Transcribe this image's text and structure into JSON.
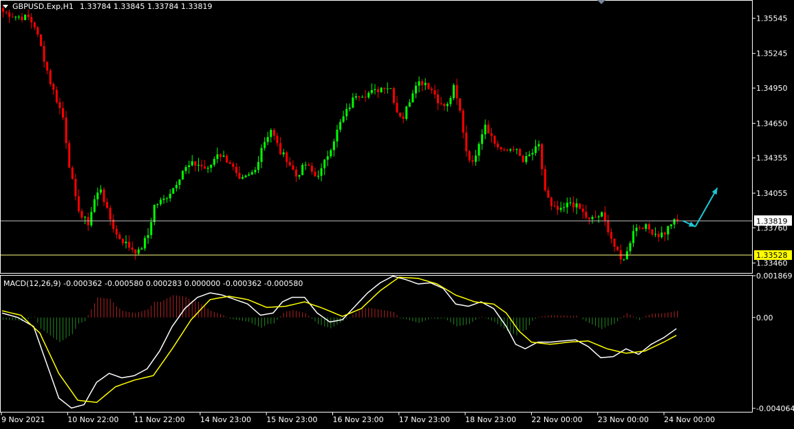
{
  "header": {
    "symbol": "GBPUSD.Exp,H1",
    "ohlc": "1.33784 1.33845 1.33784 1.33819"
  },
  "macd_header": "MACD(12,26,9) -0.000362 -0.000580 0.000283 0.000000 -0.000362 -0.000580",
  "colors": {
    "background": "#000000",
    "frame": "#ffffff",
    "bull": "#00ff00",
    "bear": "#ff0000",
    "macd_line": "#ffffff",
    "signal_line": "#ffff00",
    "hist_pos": "#b22222",
    "hist_neg": "#228b22",
    "price_line": "#c0c0c0",
    "level_line": "#ffff80",
    "level_label_bg": "#ffff00",
    "arrow": "#1fc7d4"
  },
  "chart_data": [
    {
      "type": "candlestick",
      "title": "GBPUSD.Exp,H1",
      "ylim": [
        1.3337,
        1.357
      ],
      "y_ticks": [
        "1.35545",
        "1.35245",
        "1.34950",
        "1.34650",
        "1.34355",
        "1.34055",
        "1.33760",
        "1.33460"
      ],
      "x_ticks": [
        "9 Nov 2021",
        "10 Nov 22:00",
        "11 Nov 22:00",
        "14 Nov 23:00",
        "15 Nov 23:00",
        "16 Nov 23:00",
        "17 Nov 23:00",
        "18 Nov 23:00",
        "22 Nov 00:00",
        "23 Nov 00:00",
        "24 Nov 00:00"
      ],
      "current_price": "1.33819",
      "level": "1.33528",
      "close_path": [
        [
          0,
          1.356
        ],
        [
          4,
          1.3556
        ],
        [
          8,
          1.3555
        ],
        [
          10,
          1.3548
        ],
        [
          12,
          1.353
        ],
        [
          15,
          1.35
        ],
        [
          17,
          1.3485
        ],
        [
          19,
          1.347
        ],
        [
          21,
          1.343
        ],
        [
          23,
          1.34
        ],
        [
          25,
          1.3385
        ],
        [
          27,
          1.338
        ],
        [
          29,
          1.34
        ],
        [
          31,
          1.341
        ],
        [
          33,
          1.339
        ],
        [
          36,
          1.337
        ],
        [
          40,
          1.336
        ],
        [
          43,
          1.3355
        ],
        [
          46,
          1.337
        ],
        [
          48,
          1.3395
        ],
        [
          51,
          1.34
        ],
        [
          54,
          1.341
        ],
        [
          57,
          1.3425
        ],
        [
          60,
          1.343
        ],
        [
          62,
          1.343
        ],
        [
          65,
          1.3425
        ],
        [
          68,
          1.344
        ],
        [
          72,
          1.3432
        ],
        [
          75,
          1.3415
        ],
        [
          78,
          1.342
        ],
        [
          80,
          1.3425
        ],
        [
          82,
          1.3445
        ],
        [
          85,
          1.346
        ],
        [
          88,
          1.344
        ],
        [
          90,
          1.3435
        ],
        [
          93,
          1.342
        ],
        [
          96,
          1.343
        ],
        [
          99,
          1.342
        ],
        [
          101,
          1.3425
        ],
        [
          104,
          1.3445
        ],
        [
          107,
          1.3465
        ],
        [
          109,
          1.3475
        ],
        [
          112,
          1.349
        ],
        [
          115,
          1.349
        ],
        [
          118,
          1.3492
        ],
        [
          121,
          1.3497
        ],
        [
          123,
          1.3495
        ],
        [
          125,
          1.3475
        ],
        [
          127,
          1.347
        ],
        [
          129,
          1.3485
        ],
        [
          131,
          1.35
        ],
        [
          134,
          1.35
        ],
        [
          137,
          1.349
        ],
        [
          139,
          1.348
        ],
        [
          141,
          1.348
        ],
        [
          143,
          1.3495
        ],
        [
          145,
          1.3475
        ],
        [
          147,
          1.3442
        ],
        [
          149,
          1.343
        ],
        [
          151,
          1.345
        ],
        [
          153,
          1.3465
        ],
        [
          156,
          1.3448
        ],
        [
          159,
          1.344
        ],
        [
          162,
          1.3445
        ],
        [
          165,
          1.3432
        ],
        [
          168,
          1.344
        ],
        [
          170,
          1.3445
        ],
        [
          172,
          1.3408
        ],
        [
          174,
          1.3393
        ],
        [
          177,
          1.339
        ],
        [
          180,
          1.3398
        ],
        [
          183,
          1.3392
        ],
        [
          186,
          1.3382
        ],
        [
          188,
          1.3385
        ],
        [
          190,
          1.3387
        ],
        [
          192,
          1.3375
        ],
        [
          194,
          1.336
        ],
        [
          196,
          1.3348
        ],
        [
          198,
          1.3355
        ],
        [
          200,
          1.3375
        ],
        [
          203,
          1.3378
        ],
        [
          206,
          1.3373
        ],
        [
          208,
          1.337
        ],
        [
          210,
          1.3372
        ],
        [
          212,
          1.338
        ],
        [
          214,
          1.33819
        ]
      ],
      "forecast_arrows": [
        {
          "from": [
            216,
            1.3382
          ],
          "to": [
            220,
            1.3377
          ]
        },
        {
          "from": [
            220,
            1.3377
          ],
          "to": [
            227,
            1.341
          ]
        }
      ]
    },
    {
      "type": "macd",
      "title": "MACD(12,26,9)",
      "values": [
        "-0.000362",
        "-0.000580",
        "0.000283",
        "0.000000",
        "-0.000362",
        "-0.000580"
      ],
      "ylim": [
        -0.00425,
        0.001869
      ],
      "y_ticks": [
        "0.001869",
        "0.00",
        "-0.004064"
      ],
      "macd": [
        [
          0,
          0.0002
        ],
        [
          5,
          0.0
        ],
        [
          10,
          -0.0004
        ],
        [
          14,
          -0.002
        ],
        [
          18,
          -0.0036
        ],
        [
          22,
          -0.00405
        ],
        [
          26,
          -0.0039
        ],
        [
          30,
          -0.0029
        ],
        [
          34,
          -0.0025
        ],
        [
          38,
          -0.0027
        ],
        [
          42,
          -0.0026
        ],
        [
          46,
          -0.0023
        ],
        [
          50,
          -0.0015
        ],
        [
          54,
          -0.0004
        ],
        [
          58,
          0.0004
        ],
        [
          62,
          0.0009
        ],
        [
          66,
          0.0011
        ],
        [
          70,
          0.001
        ],
        [
          74,
          0.0008
        ],
        [
          78,
          0.0006
        ],
        [
          82,
          0.0001
        ],
        [
          86,
          0.0002
        ],
        [
          89,
          0.0007
        ],
        [
          92,
          0.0009
        ],
        [
          96,
          0.0009
        ],
        [
          100,
          0.0002
        ],
        [
          104,
          -0.0002
        ],
        [
          108,
          -0.0001
        ],
        [
          112,
          0.0005
        ],
        [
          116,
          0.0011
        ],
        [
          120,
          0.00155
        ],
        [
          124,
          0.00185
        ],
        [
          128,
          0.0017
        ],
        [
          132,
          0.0015
        ],
        [
          136,
          0.00155
        ],
        [
          140,
          0.0013
        ],
        [
          144,
          0.0006
        ],
        [
          148,
          0.0005
        ],
        [
          152,
          0.0007
        ],
        [
          156,
          0.0004
        ],
        [
          160,
          -0.0004
        ],
        [
          163,
          -0.0012
        ],
        [
          166,
          -0.0014
        ],
        [
          170,
          -0.0011
        ],
        [
          174,
          -0.0011
        ],
        [
          178,
          -0.00105
        ],
        [
          182,
          -0.001
        ],
        [
          186,
          -0.0013
        ],
        [
          190,
          -0.0018
        ],
        [
          194,
          -0.00175
        ],
        [
          198,
          -0.0014
        ],
        [
          202,
          -0.00165
        ],
        [
          206,
          -0.0012
        ],
        [
          210,
          -0.0009
        ],
        [
          214,
          -0.0005
        ]
      ],
      "signal": [
        [
          0,
          0.0003
        ],
        [
          6,
          0.0001
        ],
        [
          12,
          -0.0007
        ],
        [
          18,
          -0.0025
        ],
        [
          24,
          -0.0037
        ],
        [
          30,
          -0.0038
        ],
        [
          36,
          -0.0031
        ],
        [
          42,
          -0.0028
        ],
        [
          48,
          -0.0026
        ],
        [
          54,
          -0.0014
        ],
        [
          60,
          -0.0001
        ],
        [
          66,
          0.0008
        ],
        [
          72,
          0.00095
        ],
        [
          78,
          0.0008
        ],
        [
          84,
          0.00045
        ],
        [
          90,
          0.0005
        ],
        [
          96,
          0.0007
        ],
        [
          102,
          0.0004
        ],
        [
          108,
          5e-05
        ],
        [
          114,
          0.0004
        ],
        [
          120,
          0.0012
        ],
        [
          126,
          0.0018
        ],
        [
          132,
          0.00175
        ],
        [
          138,
          0.0015
        ],
        [
          144,
          0.001
        ],
        [
          150,
          0.0007
        ],
        [
          156,
          0.0006
        ],
        [
          160,
          0.0002
        ],
        [
          164,
          -0.0006
        ],
        [
          168,
          -0.0011
        ],
        [
          174,
          -0.0012
        ],
        [
          180,
          -0.0011
        ],
        [
          186,
          -0.00105
        ],
        [
          192,
          -0.0014
        ],
        [
          198,
          -0.0016
        ],
        [
          204,
          -0.0015
        ],
        [
          210,
          -0.0011
        ],
        [
          214,
          -0.0008
        ]
      ]
    }
  ]
}
